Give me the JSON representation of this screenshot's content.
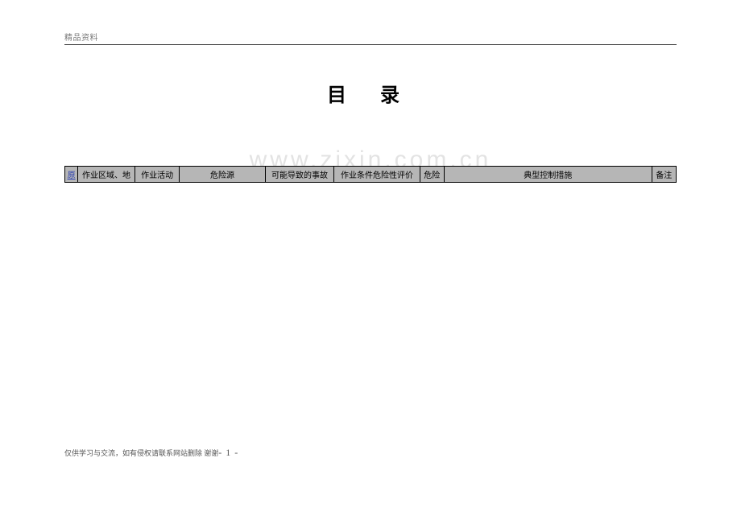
{
  "header": {
    "label": "精品资料"
  },
  "title": "目 录",
  "watermark": "www.zixin.com.cn",
  "table": {
    "headers": [
      "原",
      "作业区域、地",
      "作业活动",
      "危险源",
      "可能导致的事故",
      "作业条件危险性评价",
      "危险",
      "典型控制措施",
      "备注"
    ]
  },
  "footer": {
    "text": "仅供学习与交流，如有侵权请联系网站删除 谢谢",
    "page_prefix": "- ",
    "page_number": "1",
    "page_suffix": " -"
  }
}
